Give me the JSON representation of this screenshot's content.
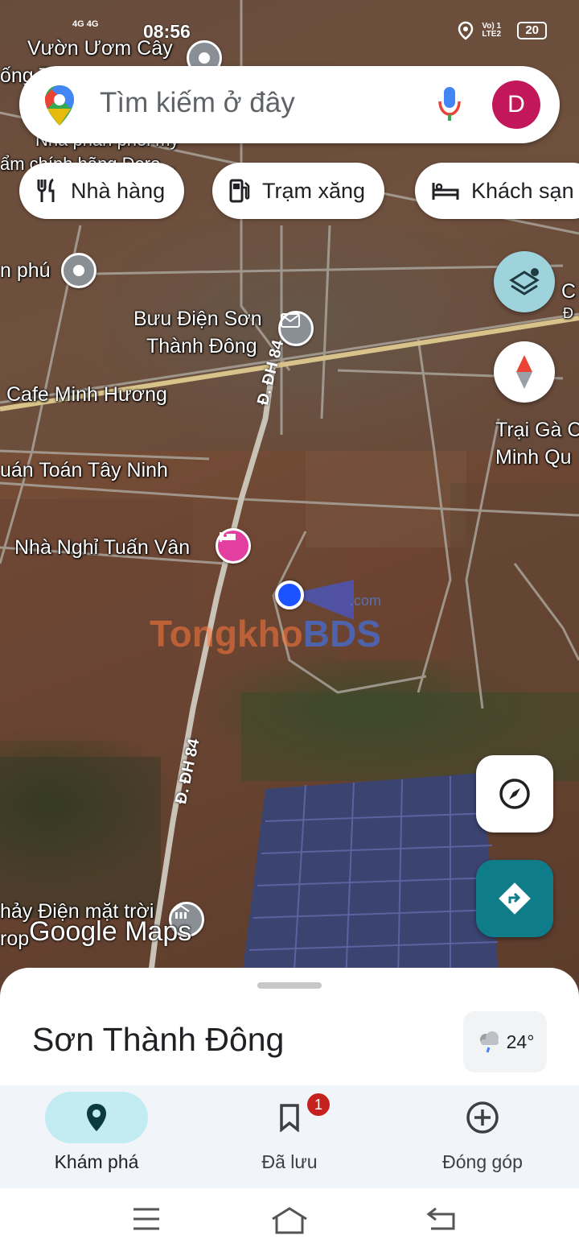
{
  "status_bar": {
    "time": "08:56",
    "network_left": "4G  4G",
    "network_right": "Vo) 1 LTE2",
    "battery": "20"
  },
  "search": {
    "placeholder": "Tìm kiếm ở đây",
    "avatar_letter": "D"
  },
  "chips": [
    {
      "label": "Nhà hàng",
      "icon": "restaurant-icon"
    },
    {
      "label": "Trạm xăng",
      "icon": "gas-station-icon"
    },
    {
      "label": "Khách sạn",
      "icon": "hotel-icon"
    }
  ],
  "map": {
    "labels": {
      "vuon_uom": "Vườn Ươm Cây",
      "ong_t": "ống T",
      "nha_phan_phoi": "Nhà phân phối mỹ",
      "pham_chinh_hang": "ẩm chính hãng Dero...",
      "n_phu": "n phú",
      "buu_dien_1": "Bưu Điện Sơn",
      "buu_dien_2": "Thành Đông",
      "cafe": "Cafe Minh Hương",
      "quan_toan": "uán Toán Tây Ninh",
      "nha_nghi": "Nhà Nghỉ Tuấn Vân",
      "trai_ga_1": "Trại Gà C",
      "trai_ga_2": "Minh Qu",
      "c_right_1": "C",
      "c_right_2": "Đ",
      "nha_may_1": "hảy Điện mặt trời",
      "nha_may_2": "rop",
      "road_dh84_a": "Đ. ĐH 84",
      "road_dh84_b": "Đ. ĐH 84"
    },
    "watermark": {
      "tong": "Tongkho",
      "bds": "BDS",
      "com": ".com"
    },
    "google_maps": "Google Maps"
  },
  "place": {
    "title": "Sơn Thành Đông",
    "temperature": "24°"
  },
  "bottom_nav": [
    {
      "label": "Khám phá",
      "active": true
    },
    {
      "label": "Đã lưu",
      "badge": "1"
    },
    {
      "label": "Đóng góp"
    }
  ],
  "colors": {
    "explore_active": "#c3ecf2",
    "badge": "#c5221f",
    "directions_fab": "#0f7c8a",
    "avatar": "#c2185b"
  }
}
